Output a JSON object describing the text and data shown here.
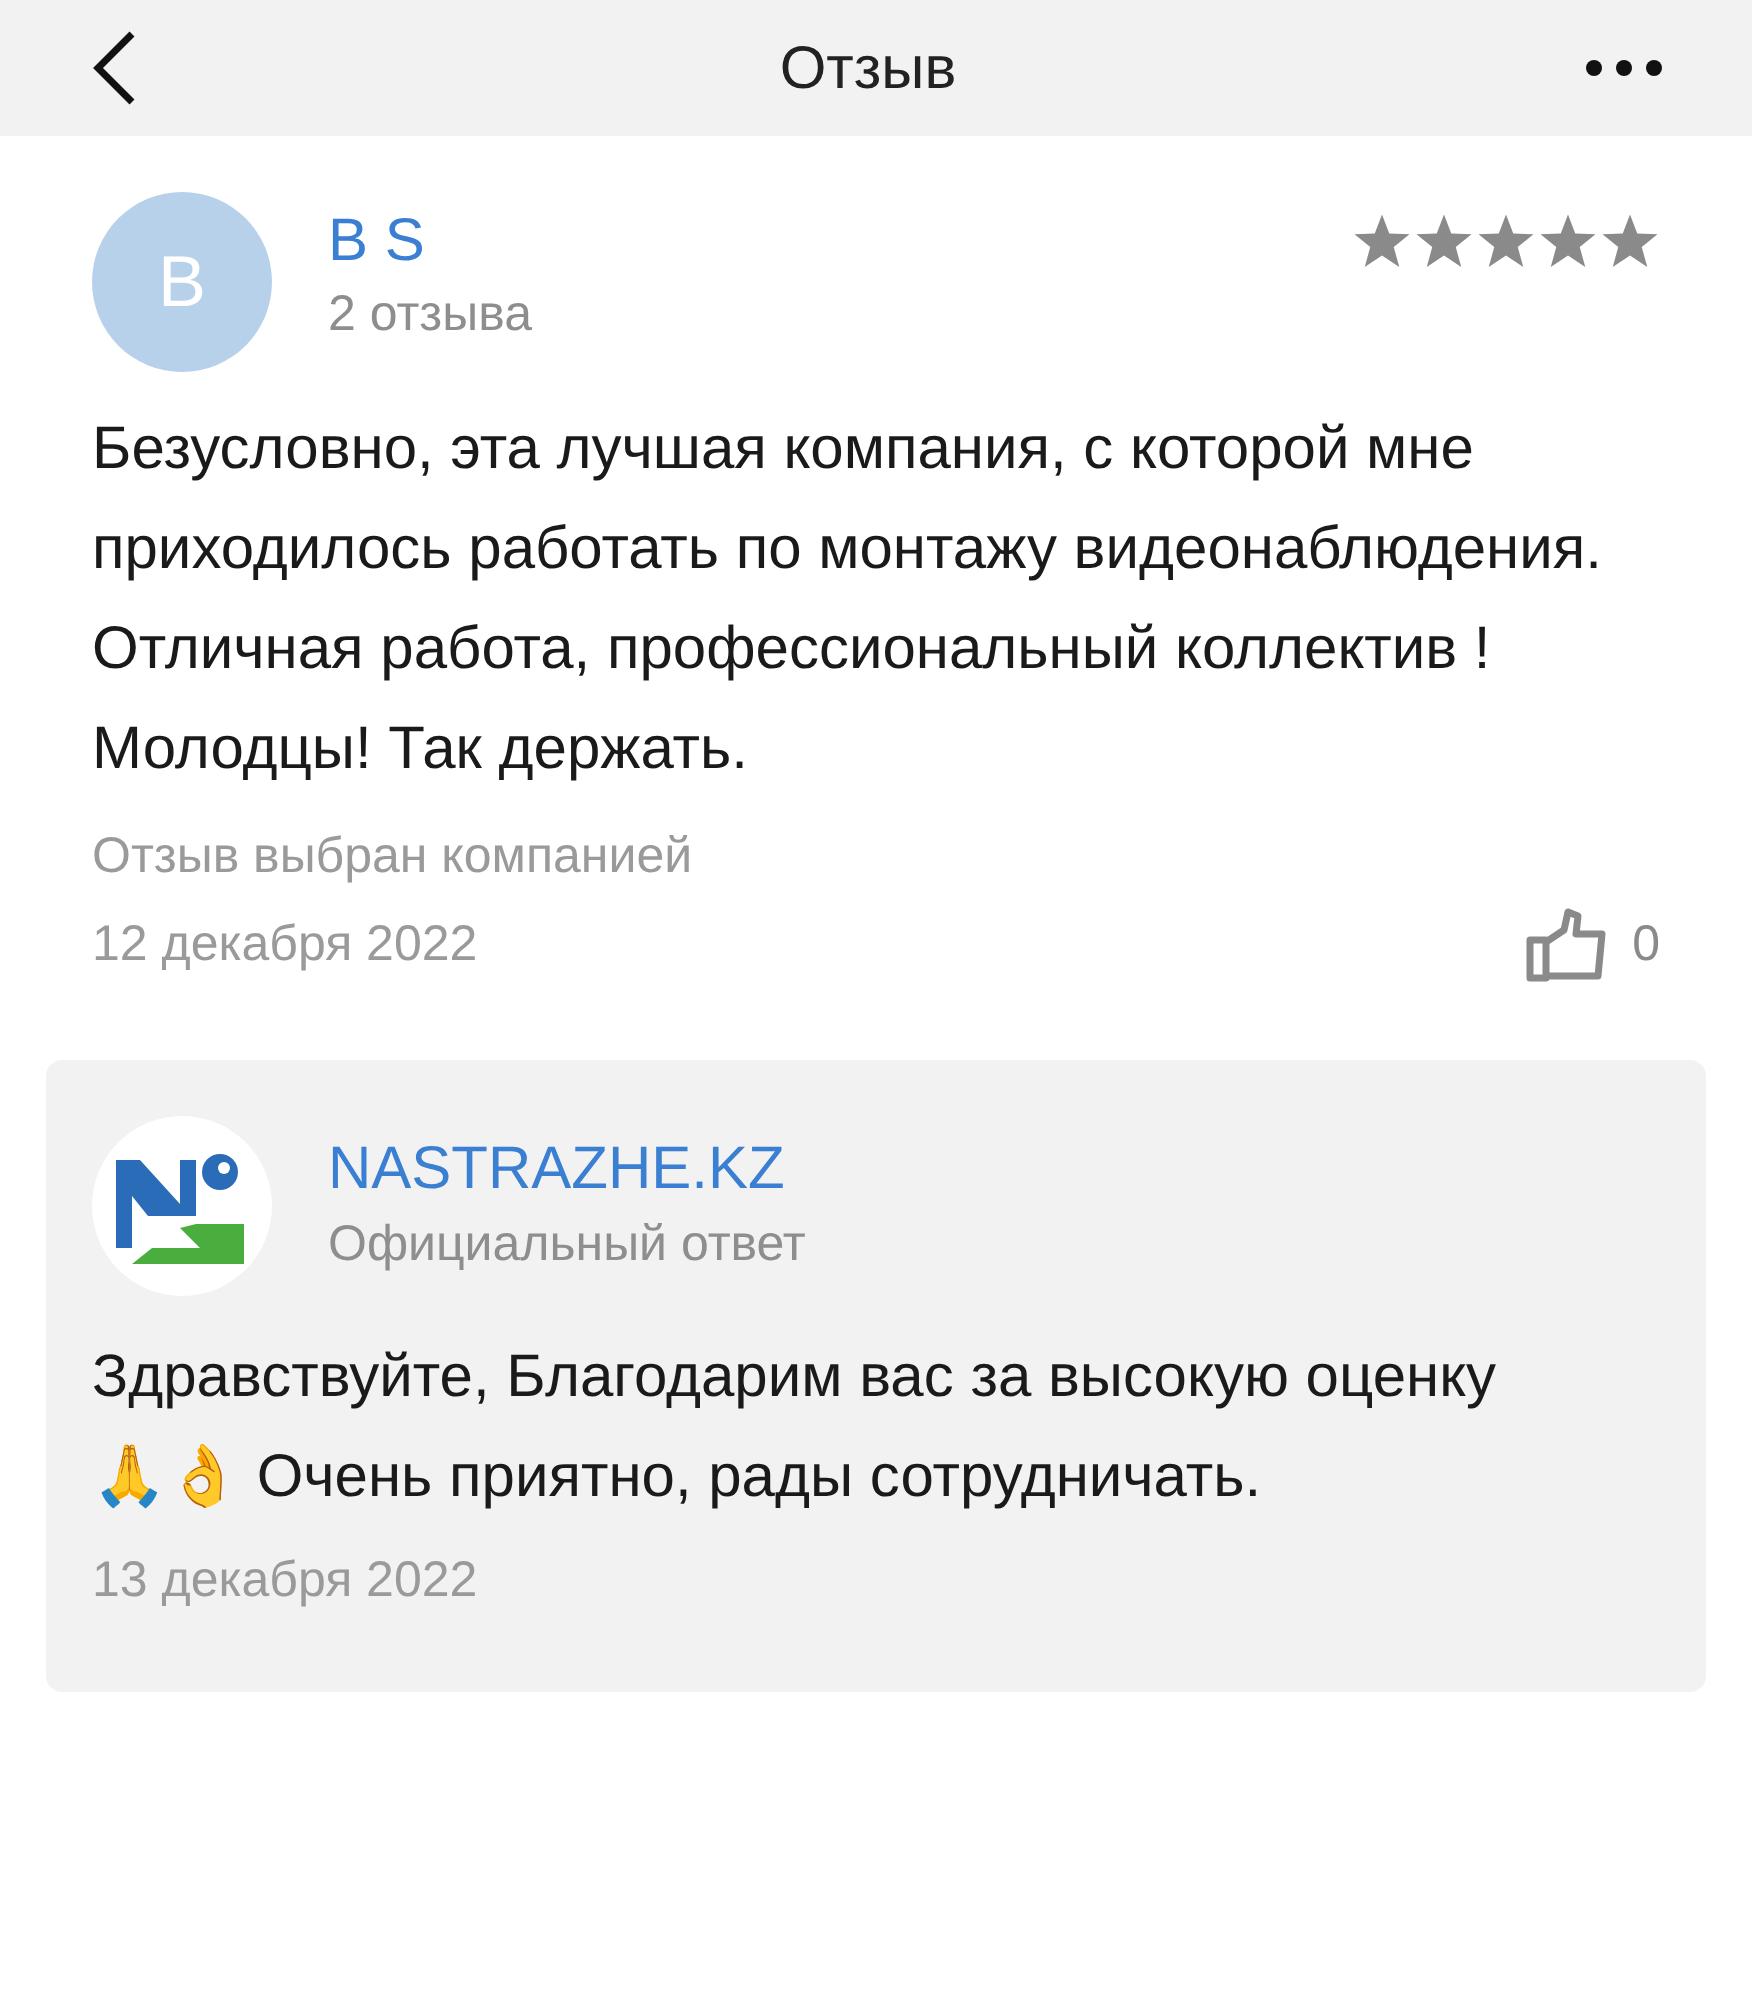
{
  "header": {
    "title": "Отзыв"
  },
  "review": {
    "avatar_letter": "B",
    "author": "B S",
    "reviews_count": "2 отзыва",
    "stars": 5,
    "text": "Безусловно, эта лучшая компания, с которой мне приходилось работать по монтажу видеонаблюдения. Отличная работа, профессиональный коллектив !Молодцы! Так держать.",
    "note": "Отзыв выбран компанией",
    "date": "12 декабря 2022",
    "likes": "0"
  },
  "reply": {
    "company": "NASTRAZHE.KZ",
    "label": "Официальный ответ",
    "text": "Здравствуйте, Благодарим вас за высокую оценку 🙏👌 Очень приятно, рады сотрудничать.",
    "date": "13 декабря 2022"
  }
}
